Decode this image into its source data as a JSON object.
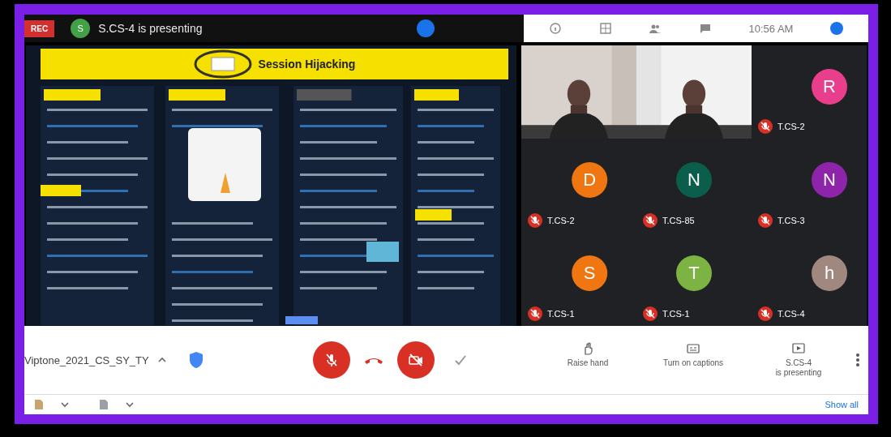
{
  "top_bar": {
    "rec_label": "REC",
    "presenter_letter": "S",
    "presenter_text": "S.CS-4 is presenting",
    "time": "10:56 AM"
  },
  "slide": {
    "title": "Session Hijacking"
  },
  "participants": [
    {
      "kind": "video"
    },
    {
      "kind": "video"
    },
    {
      "kind": "avatar",
      "letter": "R",
      "name": "T.CS-2",
      "color": "#e83e8c",
      "muted": true
    },
    {
      "kind": "avatar",
      "letter": "D",
      "name": "T.CS-2",
      "color": "#ef7610",
      "muted": true
    },
    {
      "kind": "avatar",
      "letter": "N",
      "name": "T.CS-85",
      "color": "#0b5e4c",
      "muted": true
    },
    {
      "kind": "avatar",
      "letter": "N",
      "name": "T.CS-3",
      "color": "#8e24aa",
      "muted": true
    },
    {
      "kind": "avatar",
      "letter": "S",
      "name": "T.CS-1",
      "color": "#ef7610",
      "muted": true
    },
    {
      "kind": "avatar",
      "letter": "T",
      "name": "T.CS-1",
      "color": "#7cb342",
      "muted": true
    },
    {
      "kind": "avatar",
      "letter": "h",
      "name": "T.CS-4",
      "color": "#a1887f",
      "muted": true
    }
  ],
  "controls": {
    "meeting_name": "Viptone_2021_CS_SY_TY",
    "mic_on": false,
    "camera_on": false,
    "actions": [
      {
        "kind": "hand",
        "label": "Raise hand"
      },
      {
        "kind": "captions",
        "label": "Turn on captions"
      },
      {
        "kind": "present",
        "label": "S.CS-4\nis presenting"
      }
    ]
  },
  "downloads": {
    "show_all": "Show all"
  }
}
